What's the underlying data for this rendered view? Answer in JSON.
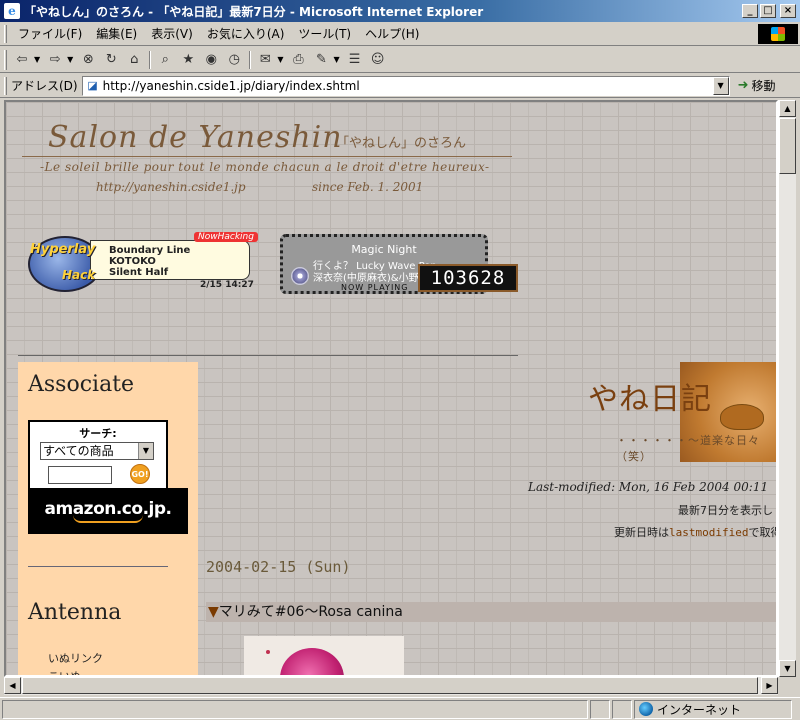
{
  "window": {
    "title": "「やねしん」のさろん - 「やね日記」最新7日分 - Microsoft Internet Explorer",
    "controls": [
      "_",
      "□",
      "×"
    ]
  },
  "menu": [
    "ファイル(F)",
    "編集(E)",
    "表示(V)",
    "お気に入り(A)",
    "ツール(T)",
    "ヘルプ(H)"
  ],
  "toolbar": {
    "icons": [
      "back-icon",
      "forward-icon",
      "stop-icon",
      "refresh-icon",
      "home-icon",
      "search-icon",
      "favorites-icon",
      "media-icon",
      "history-icon",
      "mail-icon",
      "print-icon",
      "edit-icon",
      "discuss-icon",
      "messenger-icon"
    ]
  },
  "address": {
    "label": "アドレス(D)",
    "url": "http://yaneshin.cside1.jp/diary/index.shtml",
    "go_label": "移動"
  },
  "header": {
    "title": "Salon de Yaneshin",
    "subtitle": "「やねしん」のさろん",
    "motto": "-Le soleil brille pour tout le monde chacun a le droit d'etre heureux-",
    "url": "http://yaneshin.cside1.jp",
    "since": "since Feb. 1. 2001"
  },
  "hyperlay": {
    "logo_line1": "Hyperlay",
    "logo_line2": "Hack",
    "badge": "NowHacking",
    "lines": [
      "Boundary Line",
      "KOTOKO",
      "Silent Half"
    ],
    "time": "2/15 14:27"
  },
  "nowplaying": {
    "title": "Magic Night",
    "line2": "行くよ？ Lucky Wave Pop",
    "artist": "深衣奈(中原麻衣)&小野",
    "label": "NOW PLAYING",
    "counter": "103628"
  },
  "sidebar": {
    "associate_title": "Associate",
    "search_label": "サーチ:",
    "select_value": "すべての商品",
    "go_label": "GO!",
    "amazon_logo": "amazon.co.jp.",
    "antenna_title": "Antenna",
    "antenna_links": [
      "いぬリンク",
      "こいぬ"
    ]
  },
  "diary": {
    "title": "やね日記",
    "subtitle": "・・・・・・〜道楽な日々（笑）",
    "last_modified": "Last-modified: Mon, 16 Feb 2004 00:11",
    "show_recent": "最新7日分を表示し",
    "update_note_prefix": "更新日時は",
    "update_note_link": "lastmodified",
    "update_note_suffix": "で取得",
    "entry_date": "2004-02-15 (Sun)",
    "entry_marker": "▼",
    "entry_title": "マリみて#06〜Rosa canina"
  },
  "status": {
    "zone": "インターネット"
  }
}
